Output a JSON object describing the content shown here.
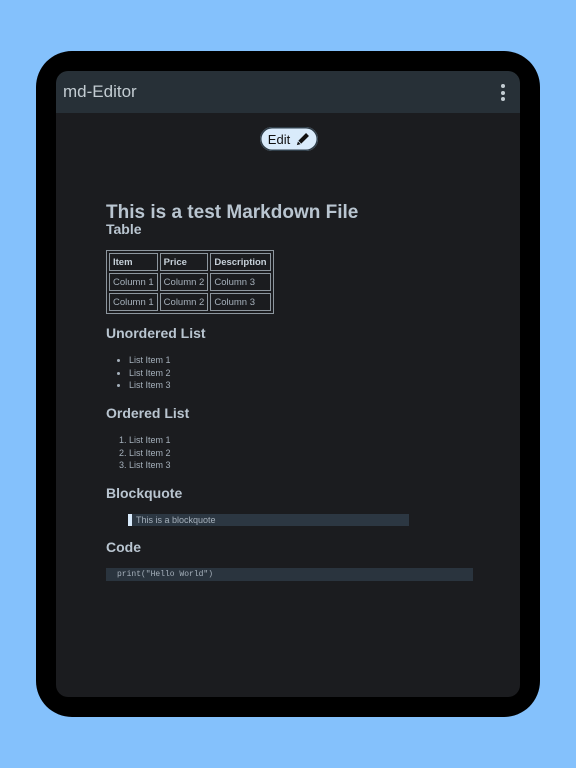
{
  "app": {
    "title": "md-Editor"
  },
  "toolbar": {
    "edit_label": "Edit"
  },
  "doc": {
    "title": "This is a test Markdown File",
    "table_heading": "Table",
    "table": {
      "headers": [
        "Item",
        "Price",
        "Description"
      ],
      "rows": [
        [
          "Column 1",
          "Column 2",
          "Column 3"
        ],
        [
          "Column 1",
          "Column 2",
          "Column 3"
        ]
      ]
    },
    "unordered_heading": "Unordered List",
    "unordered": [
      "List Item 1",
      "List Item 2",
      "List Item 3"
    ],
    "ordered_heading": "Ordered List",
    "ordered": [
      "List Item 1",
      "List Item 2",
      "List Item 3"
    ],
    "blockquote_heading": "Blockquote",
    "blockquote": "This is a blockquote",
    "code_heading": "Code",
    "code": "print(\"Hello World\")"
  },
  "colors": {
    "background": "#84c1fc",
    "appbar": "#273037",
    "button": "#d9ebfb"
  }
}
